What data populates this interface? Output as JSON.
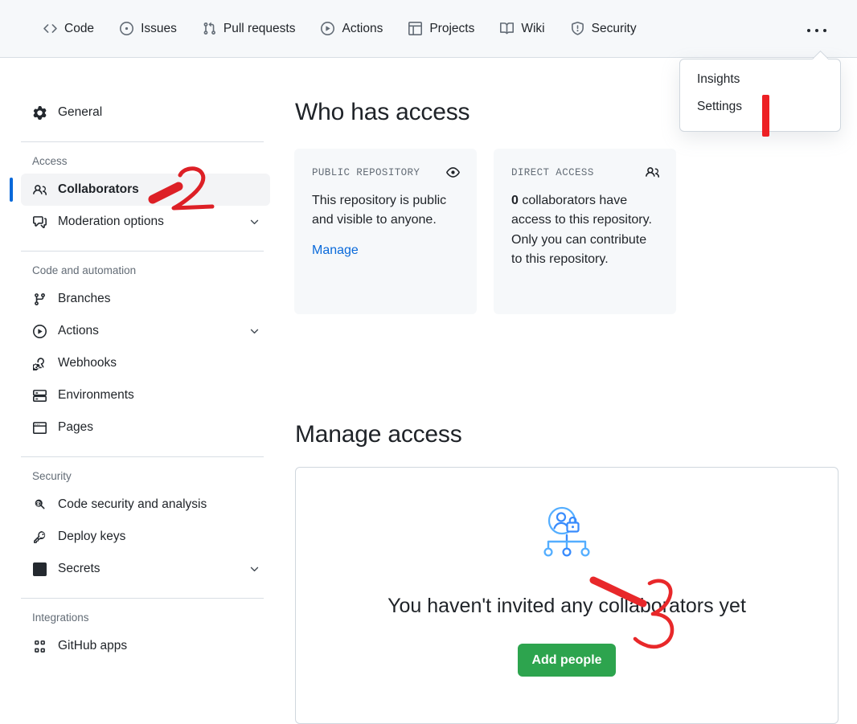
{
  "repo_nav": {
    "items": [
      {
        "label": "Code",
        "icon": "code-icon"
      },
      {
        "label": "Issues",
        "icon": "issue-opened-icon"
      },
      {
        "label": "Pull requests",
        "icon": "git-pull-request-icon"
      },
      {
        "label": "Actions",
        "icon": "play-icon"
      },
      {
        "label": "Projects",
        "icon": "table-icon"
      },
      {
        "label": "Wiki",
        "icon": "book-icon"
      },
      {
        "label": "Security",
        "icon": "shield-icon"
      }
    ],
    "more_label": "More options"
  },
  "overflow_menu": {
    "items": [
      {
        "label": "Insights"
      },
      {
        "label": "Settings"
      }
    ]
  },
  "sidebar": {
    "top_items": [
      {
        "label": "General",
        "icon": "gear-icon",
        "chevron": false,
        "selected": false
      }
    ],
    "groups": [
      {
        "title": "Access",
        "items": [
          {
            "label": "Collaborators",
            "icon": "people-icon",
            "chevron": false,
            "selected": true
          },
          {
            "label": "Moderation options",
            "icon": "comment-discussion-icon",
            "chevron": true,
            "selected": false
          }
        ]
      },
      {
        "title": "Code and automation",
        "items": [
          {
            "label": "Branches",
            "icon": "git-branch-icon",
            "chevron": false,
            "selected": false
          },
          {
            "label": "Actions",
            "icon": "play-icon",
            "chevron": true,
            "selected": false
          },
          {
            "label": "Webhooks",
            "icon": "webhook-icon",
            "chevron": false,
            "selected": false
          },
          {
            "label": "Environments",
            "icon": "server-icon",
            "chevron": false,
            "selected": false
          },
          {
            "label": "Pages",
            "icon": "browser-icon",
            "chevron": false,
            "selected": false
          }
        ]
      },
      {
        "title": "Security",
        "items": [
          {
            "label": "Code security and analysis",
            "icon": "codescan-icon",
            "chevron": false,
            "selected": false
          },
          {
            "label": "Deploy keys",
            "icon": "key-icon",
            "chevron": false,
            "selected": false
          },
          {
            "label": "Secrets",
            "icon": "asterisk-box-icon",
            "chevron": true,
            "selected": false
          }
        ]
      },
      {
        "title": "Integrations",
        "items": [
          {
            "label": "GitHub apps",
            "icon": "apps-icon",
            "chevron": false,
            "selected": false
          }
        ]
      }
    ]
  },
  "main": {
    "who_has_access_title": "Who has access",
    "cards": [
      {
        "label": "PUBLIC REPOSITORY",
        "icon": "eye-icon",
        "body_text": "This repository is public and visible to anyone.",
        "link_label": "Manage"
      },
      {
        "label": "DIRECT ACCESS",
        "icon": "people-icon",
        "count": "0",
        "body_text": " collaborators have access to this repository. Only you can contribute to this repository."
      }
    ],
    "manage_access_title": "Manage access",
    "empty_state": {
      "illustration": "user-lock-hierarchy-icon",
      "heading": "You haven't invited any collaborators yet",
      "button_label": "Add people"
    }
  },
  "annotations": [
    {
      "name": "annotation-1-settings",
      "shape": "vertical-stroke"
    },
    {
      "name": "annotation-2-collaborators",
      "shape": "digit-two-with-arrow"
    },
    {
      "name": "annotation-3-add-people",
      "shape": "digit-three-with-arrow"
    }
  ],
  "colors": {
    "accent_blue": "#0969da",
    "button_green": "#2da44e",
    "annotation_red": "#e8282a",
    "header_bg": "#f6f8fa",
    "border": "#d0d7de",
    "muted_text": "#636c76"
  }
}
